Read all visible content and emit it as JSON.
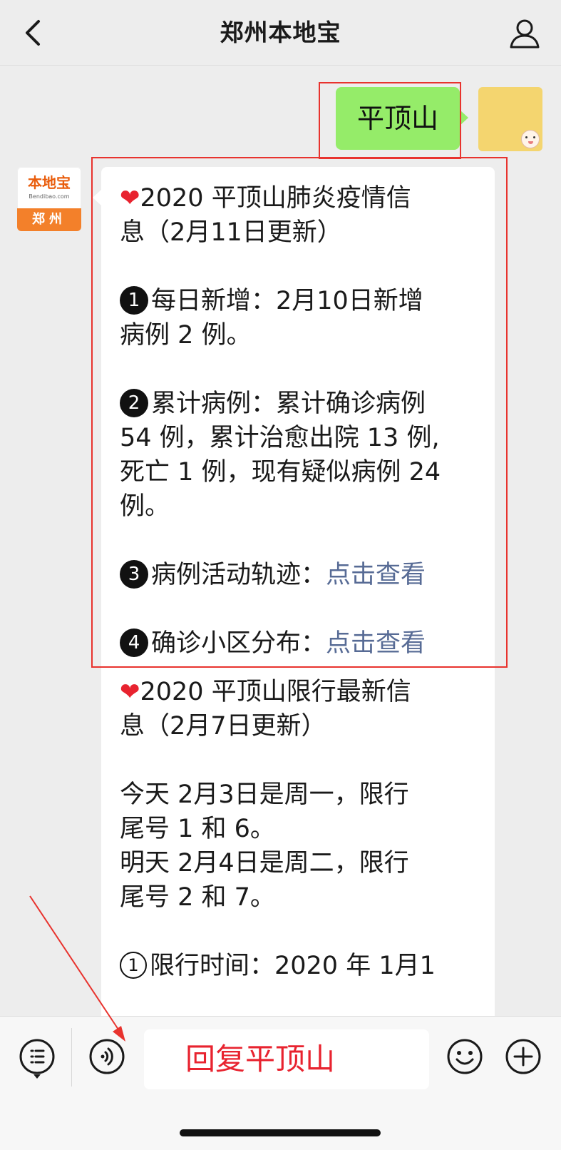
{
  "header": {
    "title": "郑州本地宝"
  },
  "sent_message": {
    "text": "平顶山"
  },
  "bot_avatar": {
    "logo_text": "本地宝",
    "domain_text": "Bendibao.com",
    "city_text": "郑州"
  },
  "received_message": {
    "heart": "❤",
    "section1_title_line1": "2020 平顶山肺炎疫情信",
    "section1_title_line2": "息（2月11日更新）",
    "item1_num": "1",
    "item1_line1": "每日新增：2月10日新增",
    "item1_line2": "病例 2 例。",
    "item2_num": "2",
    "item2_line1": "累计病例：累计确诊病例",
    "item2_line2": "54 例，累计治愈出院 13 例,",
    "item2_line3": "死亡 1 例，现有疑似病例 24",
    "item2_line4": "例。",
    "item3_num": "3",
    "item3_label": "病例活动轨迹：",
    "item3_link": "点击查看",
    "item4_num": "4",
    "item4_label": "确诊小区分布：",
    "item4_link": "点击查看",
    "section2_title_line1": "2020 平顶山限行最新信",
    "section2_title_line2": "息（2月7日更新）",
    "s2_line1": "今天 2月3日是周一，限行",
    "s2_line2": "尾号 1 和 6。",
    "s2_line3": "明天 2月4日是周二，限行",
    "s2_line4": "尾号 2 和 7。",
    "s2_item1_num": "1",
    "s2_item1_text": "限行时间：2020 年 1月1"
  },
  "input": {
    "value": "回复平顶山"
  },
  "colors": {
    "sent_bubble": "#95ec69",
    "link": "#576b95",
    "annotation_red": "#e8332e"
  },
  "icons": [
    "back-icon",
    "user-icon",
    "menu-list-icon",
    "voice-icon",
    "emoji-icon",
    "plus-icon"
  ]
}
